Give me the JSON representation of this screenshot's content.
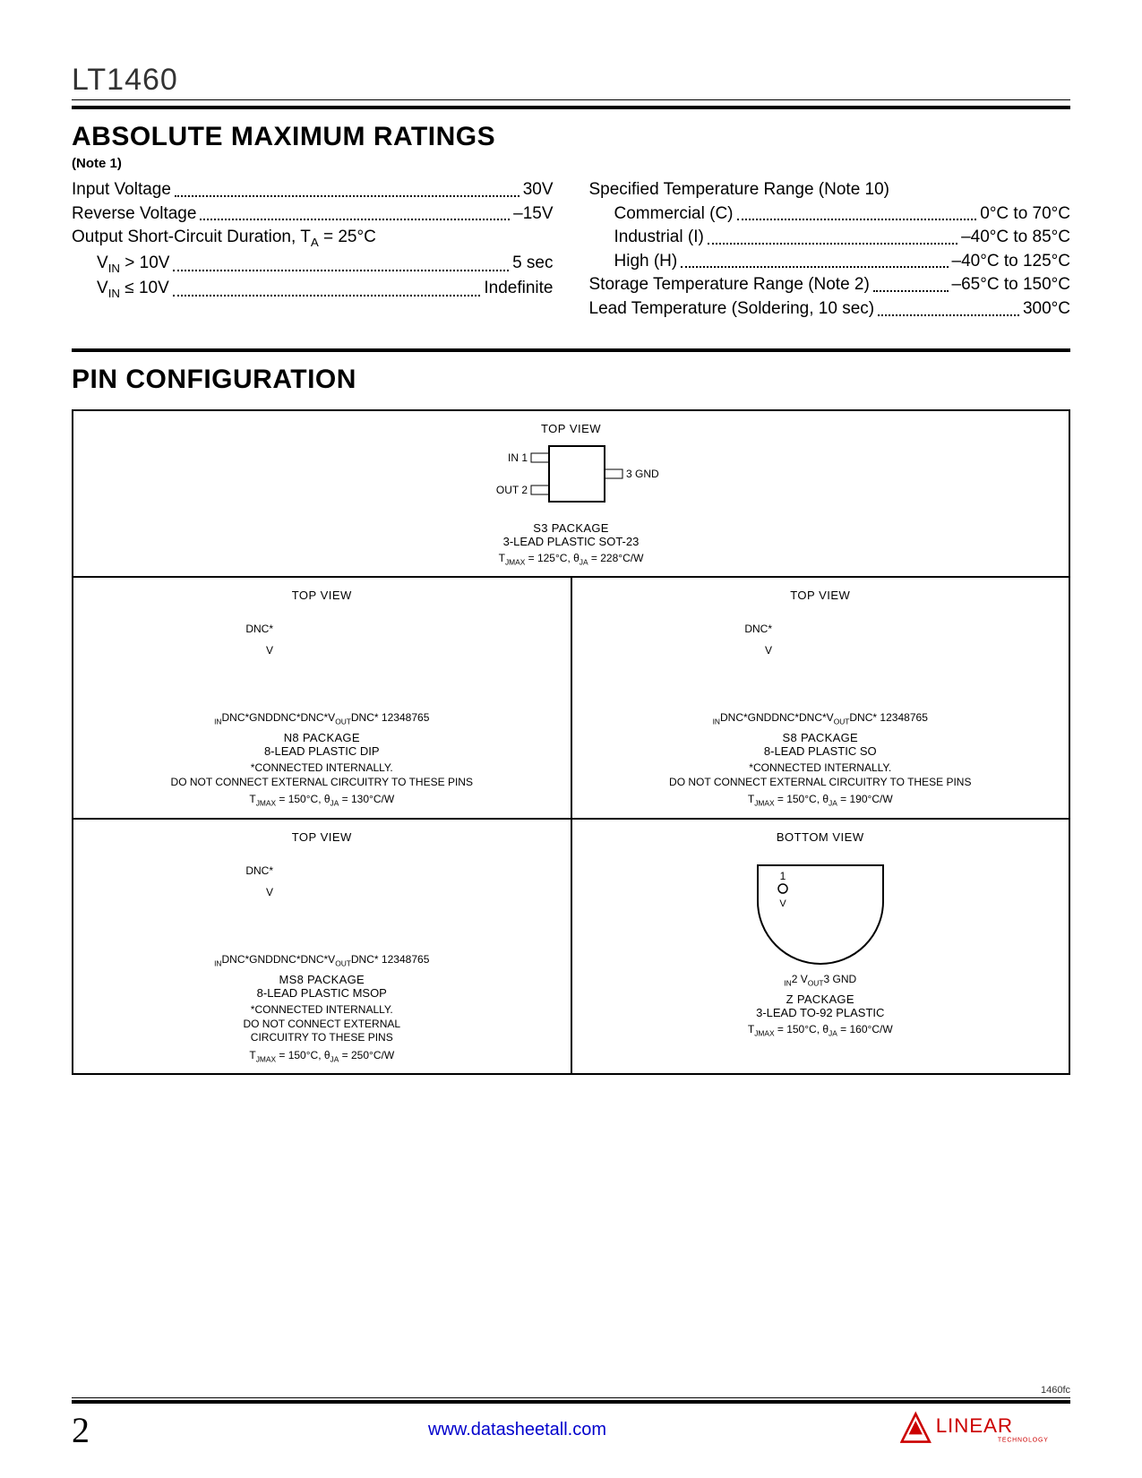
{
  "header": {
    "part_number": "LT1460"
  },
  "section1": {
    "title": "ABSOLUTE MAXIMUM RATINGS",
    "note": "(Note 1)",
    "left_rows": [
      {
        "label": "Input Voltage",
        "value": "30V",
        "indent": false
      },
      {
        "label": "Reverse Voltage",
        "value": "–15V",
        "indent": false
      },
      {
        "label_html": "Output Short-Circuit Duration, T<sub>A</sub> = 25°C",
        "value": "",
        "indent": false,
        "nodots": true
      },
      {
        "label_html": "V<sub>IN</sub> > 10V",
        "value": "5 sec",
        "indent": true
      },
      {
        "label_html": "V<sub>IN</sub> ≤ 10V",
        "value": "Indefinite",
        "indent": true
      }
    ],
    "right_rows": [
      {
        "label": "Specified Temperature Range (Note 10)",
        "value": "",
        "indent": false,
        "nodots": true
      },
      {
        "label": "Commercial (C)",
        "value": "0°C to 70°C",
        "indent": true
      },
      {
        "label": "Industrial (I)",
        "value": "–40°C to 85°C",
        "indent": true
      },
      {
        "label": "High (H)",
        "value": "–40°C to 125°C",
        "indent": true
      },
      {
        "label": "Storage Temperature Range (Note 2)",
        "value": "–65°C to 150°C",
        "indent": false
      },
      {
        "label": "Lead Temperature (Soldering, 10 sec)",
        "value": "300°C",
        "indent": false
      }
    ]
  },
  "section2": {
    "title": "PIN CONFIGURATION",
    "packages": {
      "s3": {
        "view": "TOP VIEW",
        "left_pins": [
          "IN 1",
          "OUT 2"
        ],
        "right_pins": [
          "3 GND"
        ],
        "name": "S3 PACKAGE",
        "desc": "3-LEAD PLASTIC SOT-23",
        "thermal_html": "T<sub>JMAX</sub> = 125°C, θ<sub>JA</sub> = 228°C/W"
      },
      "n8": {
        "view": "TOP VIEW",
        "left_pins": [
          "DNC*|1",
          "V<sub>IN</sub>|2",
          "DNC*|3",
          "GND|4"
        ],
        "right_pins": [
          "8|DNC*",
          "7|DNC*",
          "6|V<sub>OUT</sub>",
          "5|DNC*"
        ],
        "name": "N8 PACKAGE",
        "desc": "8-LEAD PLASTIC DIP",
        "note": "*CONNECTED INTERNALLY.\nDO NOT CONNECT EXTERNAL CIRCUITRY TO THESE PINS",
        "thermal_html": "T<sub>JMAX</sub> = 150°C, θ<sub>JA</sub> = 130°C/W"
      },
      "s8": {
        "view": "TOP VIEW",
        "left_pins": [
          "DNC*|1",
          "V<sub>IN</sub>|2",
          "DNC*|3",
          "GND|4"
        ],
        "right_pins": [
          "8|DNC*",
          "7|DNC*",
          "6|V<sub>OUT</sub>",
          "5|DNC*"
        ],
        "name": "S8 PACKAGE",
        "desc": "8-LEAD PLASTIC SO",
        "note": "*CONNECTED INTERNALLY.\nDO NOT CONNECT EXTERNAL CIRCUITRY TO THESE PINS",
        "thermal_html": "T<sub>JMAX</sub> = 150°C, θ<sub>JA</sub> = 190°C/W"
      },
      "ms8": {
        "view": "TOP VIEW",
        "left_pins": [
          "DNC*|1",
          "V<sub>IN</sub>|2",
          "DNC*|3",
          "GND|4"
        ],
        "right_pins": [
          "8|DNC*",
          "7|DNC*",
          "6|V<sub>OUT</sub>",
          "5|DNC*"
        ],
        "name": "MS8 PACKAGE",
        "desc": "8-LEAD PLASTIC MSOP",
        "note": "*CONNECTED INTERNALLY.\nDO NOT CONNECT EXTERNAL\nCIRCUITRY TO THESE PINS",
        "thermal_html": "T<sub>JMAX</sub> = 150°C, θ<sub>JA</sub> = 250°C/W"
      },
      "z": {
        "view": "BOTTOM VIEW",
        "pins": [
          "1|V<sub>IN</sub>",
          "2|V<sub>OUT</sub>",
          "3|GND"
        ],
        "name": "Z PACKAGE",
        "desc": "3-LEAD TO-92 PLASTIC",
        "thermal_html": "T<sub>JMAX</sub> = 150°C, θ<sub>JA</sub> = 160°C/W"
      }
    }
  },
  "footer": {
    "doc_code": "1460fc",
    "page_number": "2",
    "url": "www.datasheetall.com",
    "logo_text": "LINEAR",
    "logo_sub": "TECHNOLOGY"
  }
}
